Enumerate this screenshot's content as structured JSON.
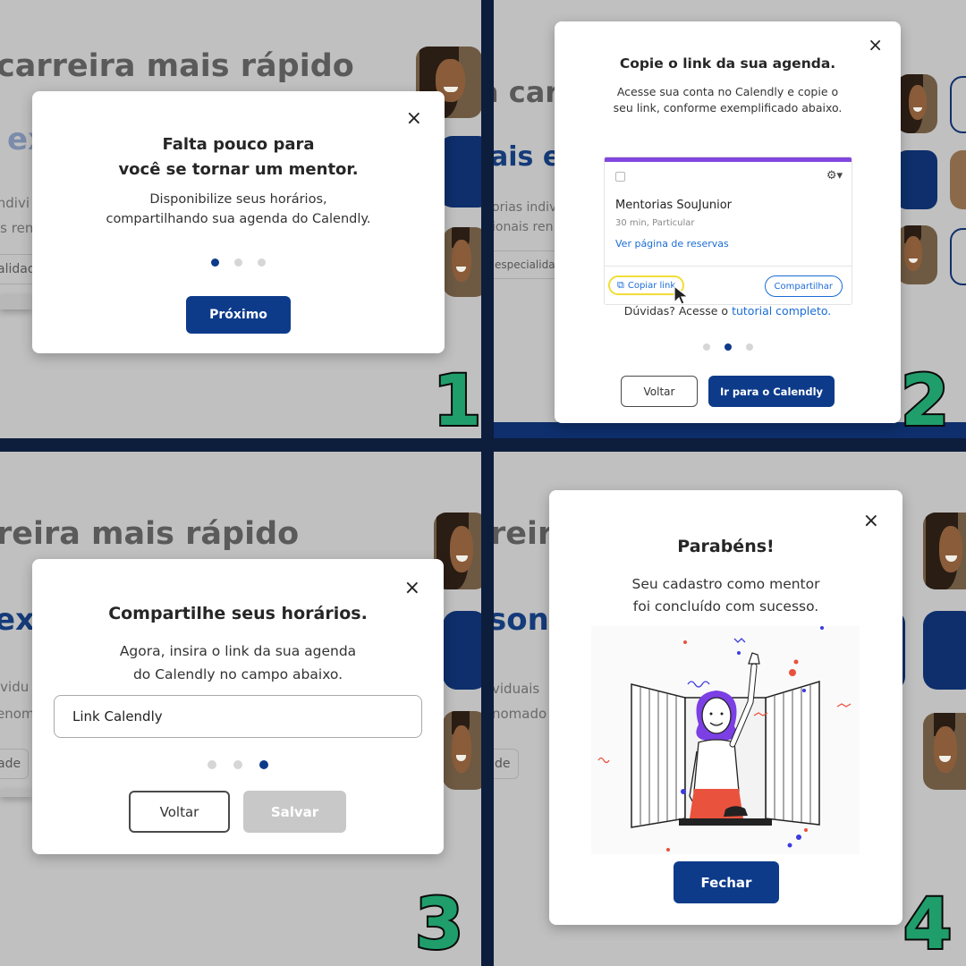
{
  "background": {
    "heading_line1": "carreira mais rápido",
    "heading_line2_p1": "ex",
    "heading_p2": "a carr",
    "sub_p2": "ais ex",
    "text_p1_a": "s indivi",
    "text_p1_b": "is ren",
    "chip_p1": "alidad",
    "text_p2_a": "orias indiv",
    "text_p2_b": "ionais ren",
    "chip_p2": "especialidad",
    "heading_p3": "reira mais rápido",
    "sub_p3": "exp",
    "text_p3_a": "ividu",
    "text_p3_b": "enom",
    "chip_p3": "ade",
    "heading_p4": "reira",
    "sub_p4": "sona",
    "text_p4_a": "viduais",
    "text_p4_b": "nomado",
    "chip_p4": "de"
  },
  "step1": {
    "number": "1",
    "title_line1": "Falta pouco para",
    "title_line2": "você se tornar um mentor.",
    "text_line1": "Disponibilize seus horários,",
    "text_line2": "compartilhando sua agenda do Calendly.",
    "next_label": "Próximo",
    "close_symbol": "×"
  },
  "step2": {
    "number": "2",
    "title": "Copie o link da sua agenda.",
    "text_line1": "Acesse sua conta no Calendly e copie o",
    "text_line2": "seu link, conforme exemplificado abaixo.",
    "card": {
      "event_name": "Mentorias SouJunior",
      "event_meta": "30 min, Particular",
      "booking_link": "Ver página de reservas",
      "copy_link": "Copiar link",
      "share": "Compartilhar"
    },
    "help_text": "Dúvidas? Acesse o",
    "help_link": "tutorial completo.",
    "back_label": "Voltar",
    "go_label": "Ir para o Calendly",
    "close_symbol": "×"
  },
  "step3": {
    "number": "3",
    "title": "Compartilhe seus horários.",
    "text_line1": "Agora, insira o link da sua agenda",
    "text_line2": "do Calendly no campo abaixo.",
    "input_value": "Link Calendly",
    "back_label": "Voltar",
    "save_label": "Salvar",
    "close_symbol": "×"
  },
  "step4": {
    "number": "4",
    "title": "Parabéns!",
    "text_line1": "Seu cadastro como mentor",
    "text_line2": "foi concluído com sucesso.",
    "close_label": "Fechar",
    "close_symbol": "×"
  },
  "colors": {
    "primary": "#0d3b8a",
    "accent_green": "#1f9e6b",
    "divider_navy": "#0d1d3c",
    "calendly_purple": "#8246e0"
  }
}
